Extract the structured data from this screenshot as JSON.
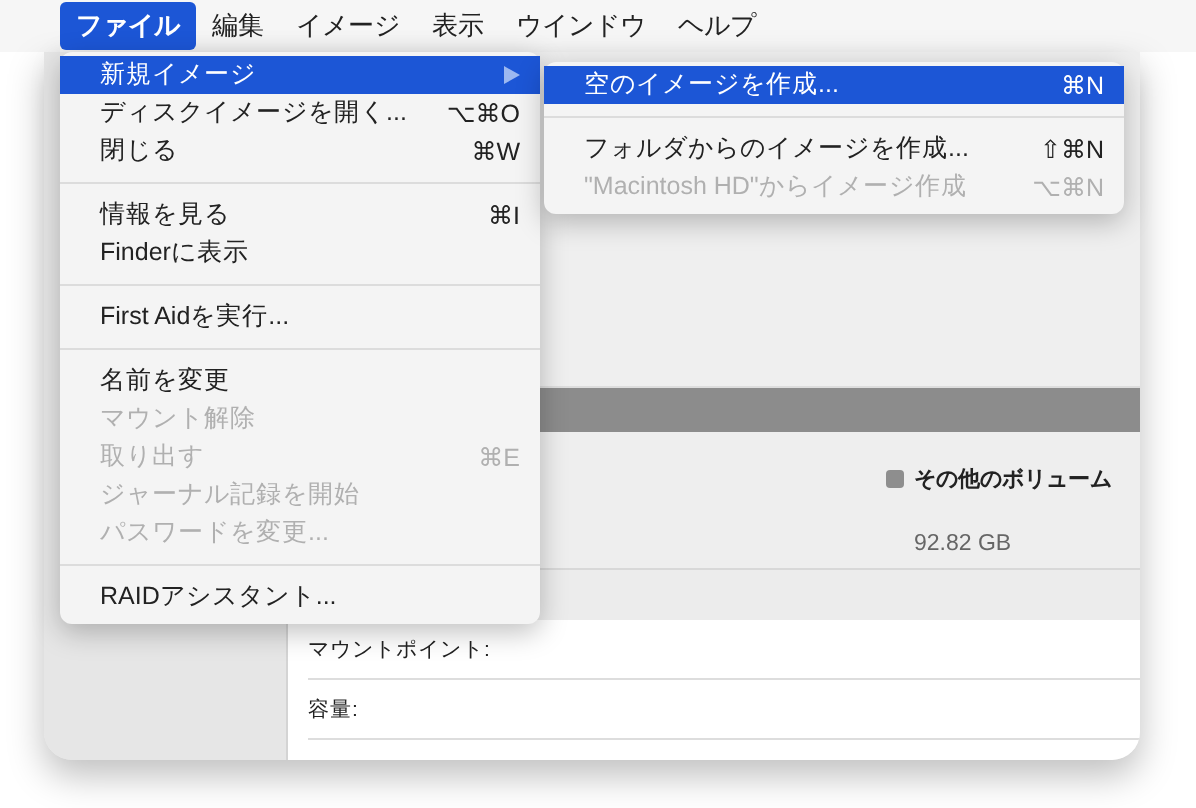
{
  "menubar": [
    {
      "label": "ファイル",
      "selected": true
    },
    {
      "label": "編集",
      "selected": false
    },
    {
      "label": "イメージ",
      "selected": false
    },
    {
      "label": "表示",
      "selected": false
    },
    {
      "label": "ウインドウ",
      "selected": false
    },
    {
      "label": "ヘルプ",
      "selected": false
    }
  ],
  "file_menu": [
    [
      {
        "label": "新規イメージ",
        "selected": true,
        "disabled": false,
        "submenu": true
      },
      {
        "label": "ディスクイメージを開く...",
        "shortcut": "⌥⌘O",
        "selected": false,
        "disabled": false,
        "submenu": false
      },
      {
        "label": "閉じる",
        "shortcut": "⌘W",
        "selected": false,
        "disabled": false,
        "submenu": false
      }
    ],
    [
      {
        "label": "情報を見る",
        "shortcut": "⌘I",
        "selected": false,
        "disabled": false,
        "submenu": false
      },
      {
        "label": "Finderに表示",
        "selected": false,
        "disabled": false,
        "submenu": false
      }
    ],
    [
      {
        "label": "First Aidを実行...",
        "selected": false,
        "disabled": false,
        "submenu": false
      }
    ],
    [
      {
        "label": "名前を変更",
        "selected": false,
        "disabled": false,
        "submenu": false
      },
      {
        "label": "マウント解除",
        "selected": false,
        "disabled": true,
        "submenu": false
      },
      {
        "label": "取り出す",
        "shortcut": "⌘E",
        "selected": false,
        "disabled": true,
        "submenu": false
      },
      {
        "label": "ジャーナル記録を開始",
        "selected": false,
        "disabled": true,
        "submenu": false
      },
      {
        "label": "パスワードを変更...",
        "selected": false,
        "disabled": true,
        "submenu": false
      }
    ],
    [
      {
        "label": "RAIDアシスタント...",
        "selected": false,
        "disabled": false,
        "submenu": false
      }
    ]
  ],
  "submenu": [
    [
      {
        "label": "空のイメージを作成...",
        "shortcut": "⌘N",
        "selected": true,
        "disabled": false
      }
    ],
    [
      {
        "label": "フォルダからのイメージを作成...",
        "shortcut": "⇧⌘N",
        "selected": false,
        "disabled": false
      },
      {
        "label": "\"Macintosh HD\"からイメージ作成",
        "shortcut": "⌥⌘N",
        "selected": false,
        "disabled": true
      }
    ]
  ],
  "legend": {
    "label": "その他のボリューム",
    "size": "92.82 GB",
    "color": "#8e8e8e"
  },
  "info_rows": [
    {
      "label": "マウントポイント:"
    },
    {
      "label": "容量:"
    }
  ]
}
